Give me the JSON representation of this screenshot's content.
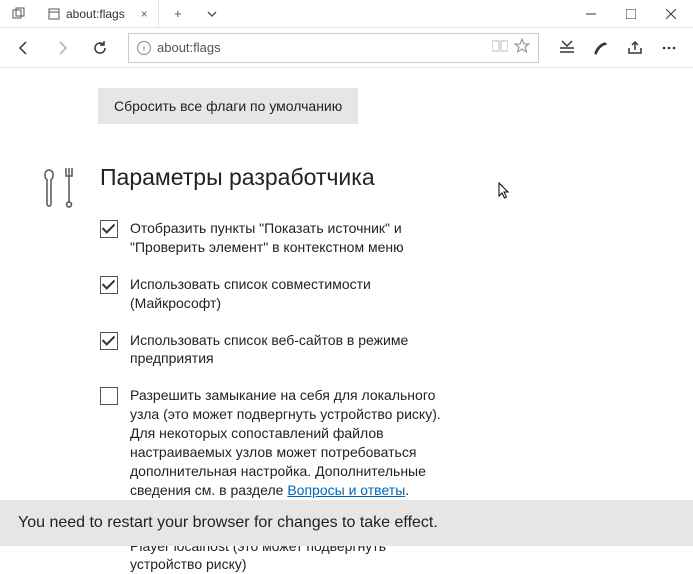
{
  "window": {
    "minimize": "—",
    "maximize": "□",
    "close": "×"
  },
  "tab": {
    "title": "about:flags"
  },
  "addressbar": {
    "url": "about:flags"
  },
  "page": {
    "reset_button": "Сбросить все флаги по умолчанию",
    "section_title": "Параметры разработчика",
    "items": [
      {
        "checked": true,
        "label": "Отобразить пункты \"Показать источник\" и \"Проверить элемент\" в контекстном меню"
      },
      {
        "checked": true,
        "label": "Использовать список совместимости (Майкрософт)"
      },
      {
        "checked": true,
        "label": "Использовать список веб-сайтов в режиме предприятия"
      },
      {
        "checked": false,
        "label": "Разрешить замыкание на себя для локального узла (это может подвергнуть устройство риску). Для некоторых сопоставлений файлов настраиваемых узлов может потребоваться дополнительная настройка. Дополнительные сведения см. в разделе ",
        "link": "Вопросы и ответы"
      },
      {
        "checked": false,
        "label": "Разрешить замыкание на себя для Adobe Flash Player localhost (это может подвергнуть устройство риску)"
      }
    ]
  },
  "restart_message": "You need to restart your browser for changes to take effect."
}
